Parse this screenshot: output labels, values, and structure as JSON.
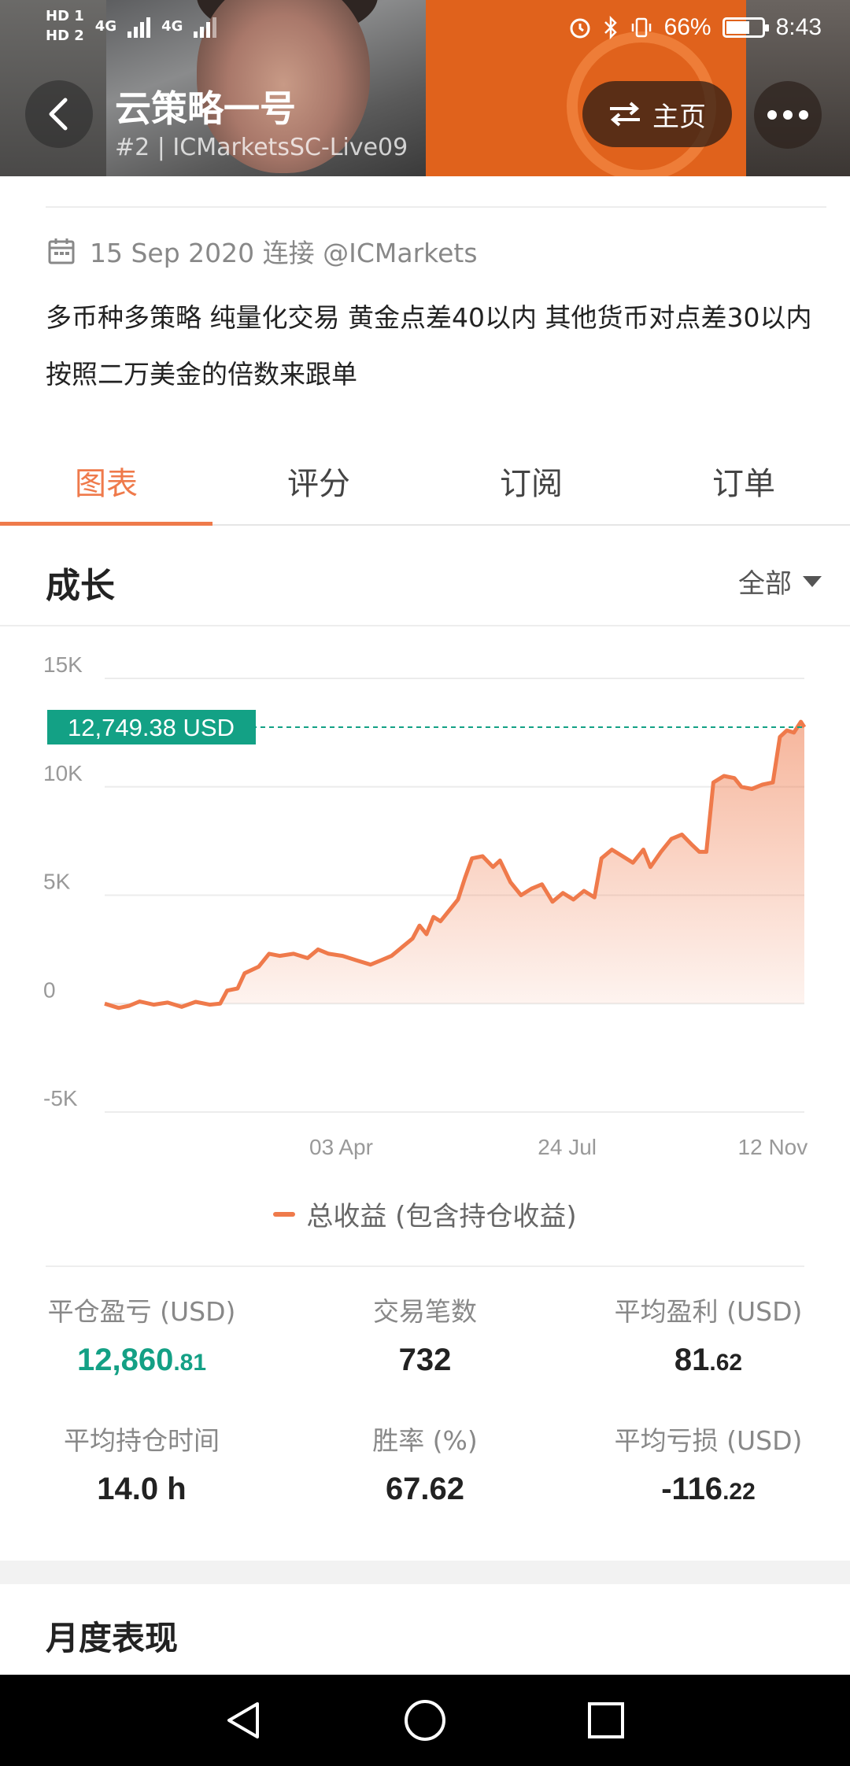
{
  "status_bar": {
    "sim1": "HD 1",
    "sim2": "HD 2",
    "net1": "4G",
    "net2": "4G",
    "battery_pct": "66%",
    "battery_level": 0.66,
    "time": "8:43"
  },
  "header": {
    "title": "云策略一号",
    "subtitle": "#2 | ICMarketsSC-Live09",
    "home_label": "主页"
  },
  "meta": {
    "date_text": "15 Sep 2020 连接 @ICMarkets"
  },
  "description": "多币种多策略  纯量化交易  黄金点差40以内  其他货币对点差30以内  按照二万美金的倍数来跟单",
  "tabs": [
    {
      "label": "图表",
      "active": true
    },
    {
      "label": "评分",
      "active": false
    },
    {
      "label": "订阅",
      "active": false
    },
    {
      "label": "订单",
      "active": false
    }
  ],
  "section": {
    "title": "成长",
    "filter_label": "全部"
  },
  "chart_data": {
    "type": "area",
    "series_color": "#ef7a4b",
    "badge_color": "#13a185",
    "current_value_label": "12,749.38 USD",
    "current_value": 12749.38,
    "ylim": [
      -5000,
      15000
    ],
    "y_ticks": [
      {
        "value": 15000,
        "label": "15K"
      },
      {
        "value": 10000,
        "label": "10K"
      },
      {
        "value": 5000,
        "label": "5K"
      },
      {
        "value": 0,
        "label": "0"
      },
      {
        "value": -5000,
        "label": "-5K"
      }
    ],
    "x_ticks": [
      {
        "t": 0.338,
        "label": "03 Apr"
      },
      {
        "t": 0.661,
        "label": "24 Jul"
      },
      {
        "t": 0.983,
        "label": "12 Nov"
      }
    ],
    "series": [
      {
        "name": "总收益 (包含持仓收益)",
        "points": [
          [
            0.0,
            0
          ],
          [
            0.02,
            -200
          ],
          [
            0.035,
            -100
          ],
          [
            0.05,
            100
          ],
          [
            0.07,
            -50
          ],
          [
            0.09,
            50
          ],
          [
            0.11,
            -150
          ],
          [
            0.13,
            80
          ],
          [
            0.15,
            -50
          ],
          [
            0.165,
            0
          ],
          [
            0.175,
            600
          ],
          [
            0.19,
            700
          ],
          [
            0.2,
            1400
          ],
          [
            0.22,
            1700
          ],
          [
            0.235,
            2300
          ],
          [
            0.25,
            2200
          ],
          [
            0.27,
            2300
          ],
          [
            0.29,
            2100
          ],
          [
            0.305,
            2500
          ],
          [
            0.32,
            2300
          ],
          [
            0.34,
            2200
          ],
          [
            0.36,
            2000
          ],
          [
            0.38,
            1800
          ],
          [
            0.395,
            2000
          ],
          [
            0.41,
            2200
          ],
          [
            0.425,
            2600
          ],
          [
            0.44,
            3000
          ],
          [
            0.45,
            3600
          ],
          [
            0.46,
            3200
          ],
          [
            0.47,
            4000
          ],
          [
            0.48,
            3800
          ],
          [
            0.495,
            4400
          ],
          [
            0.505,
            4800
          ],
          [
            0.515,
            5800
          ],
          [
            0.525,
            6700
          ],
          [
            0.54,
            6800
          ],
          [
            0.555,
            6300
          ],
          [
            0.565,
            6600
          ],
          [
            0.58,
            5600
          ],
          [
            0.595,
            5000
          ],
          [
            0.61,
            5300
          ],
          [
            0.625,
            5500
          ],
          [
            0.64,
            4700
          ],
          [
            0.655,
            5100
          ],
          [
            0.67,
            4800
          ],
          [
            0.685,
            5200
          ],
          [
            0.7,
            4900
          ],
          [
            0.71,
            6700
          ],
          [
            0.725,
            7100
          ],
          [
            0.74,
            6800
          ],
          [
            0.755,
            6500
          ],
          [
            0.77,
            7100
          ],
          [
            0.78,
            6300
          ],
          [
            0.795,
            7000
          ],
          [
            0.81,
            7600
          ],
          [
            0.825,
            7800
          ],
          [
            0.84,
            7300
          ],
          [
            0.85,
            7000
          ],
          [
            0.86,
            7000
          ],
          [
            0.87,
            10200
          ],
          [
            0.885,
            10500
          ],
          [
            0.9,
            10400
          ],
          [
            0.91,
            10000
          ],
          [
            0.925,
            9900
          ],
          [
            0.94,
            10100
          ],
          [
            0.955,
            10200
          ],
          [
            0.965,
            12300
          ],
          [
            0.975,
            12600
          ],
          [
            0.985,
            12500
          ],
          [
            0.995,
            13000
          ],
          [
            1.0,
            12749
          ]
        ]
      }
    ]
  },
  "legend_label": "总收益 (包含持仓收益)",
  "stats": {
    "closed_pl": {
      "label": "平仓盈亏 (USD)",
      "int": "12,860",
      "dec": ".81"
    },
    "trades": {
      "label": "交易笔数",
      "value": "732"
    },
    "avg_profit": {
      "label": "平均盈利 (USD)",
      "int": "81",
      "dec": ".62"
    },
    "avg_hold": {
      "label": "平均持仓时间",
      "value": "14.0 h"
    },
    "win_rate": {
      "label": "胜率 (%)",
      "value": "67.62"
    },
    "avg_loss": {
      "label": "平均亏损 (USD)",
      "int": "-116",
      "dec": ".22"
    }
  },
  "monthly_title": "月度表现",
  "icons": {
    "back": "chevron-left-icon",
    "swap": "swap-arrows-icon",
    "more": "more-dots-icon",
    "calendar": "calendar-icon",
    "caret": "caret-down-icon",
    "alarm": "alarm-icon",
    "bluetooth": "bluetooth-icon",
    "vibrate": "vibrate-icon",
    "nav_back": "nav-back-icon",
    "nav_home": "nav-home-icon",
    "nav_recent": "nav-recent-icon"
  }
}
